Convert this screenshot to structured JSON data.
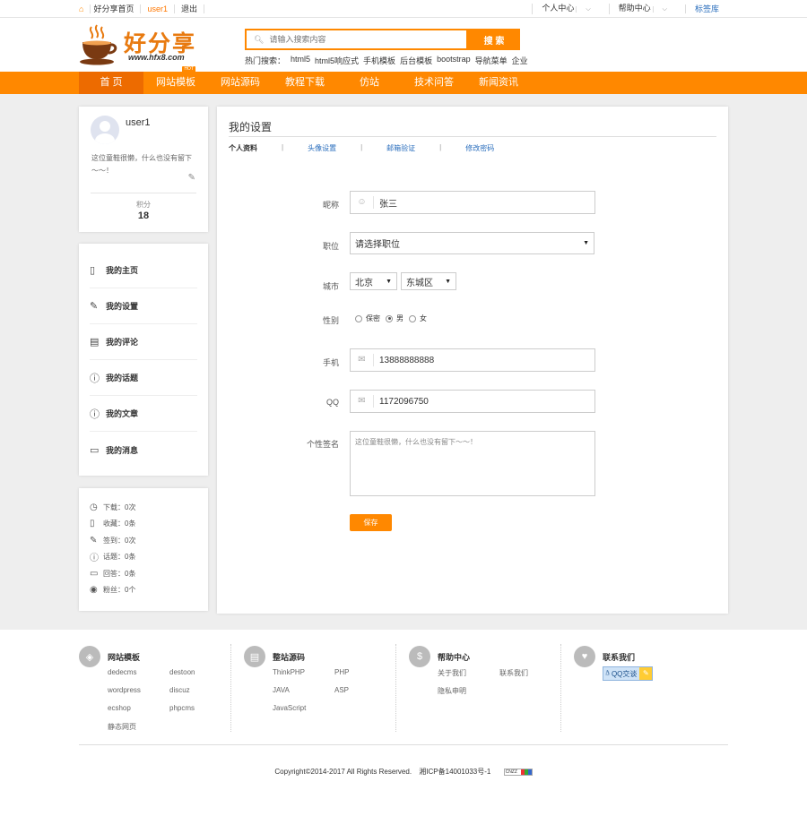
{
  "topbar": {
    "home": "好分享首页",
    "user": "user1",
    "logout": "退出",
    "right": [
      "个人中心",
      "帮助中心",
      "标签库"
    ]
  },
  "logo": {
    "title": "好分享",
    "url": "www.hfx8.com"
  },
  "search": {
    "placeholder": "请输入搜索内容",
    "button": "搜 索"
  },
  "hot_search": {
    "label": "热门搜索：",
    "items": [
      "html5",
      "html5响应式",
      "手机模板",
      "后台模板",
      "bootstrap",
      "导航菜单",
      "企业"
    ]
  },
  "nav": {
    "items": [
      "首 页",
      "网站模板",
      "网站源码",
      "教程下载",
      "仿站",
      "技术问答",
      "新闻资讯"
    ],
    "hot_badge": "HOT",
    "active_index": 0
  },
  "profile": {
    "username": "user1",
    "signature": "这位童鞋很懒，什么也没有留下～～！",
    "points_label": "积分",
    "points_value": "18"
  },
  "menu": {
    "items": [
      {
        "label": "我的主页",
        "icon": "home-doc-icon"
      },
      {
        "label": "我的设置",
        "icon": "pencil-icon"
      },
      {
        "label": "我的评论",
        "icon": "clipboard-icon"
      },
      {
        "label": "我的话题",
        "icon": "question-icon"
      },
      {
        "label": "我的文章",
        "icon": "question-icon"
      },
      {
        "label": "我的消息",
        "icon": "message-icon"
      }
    ]
  },
  "stats": {
    "items": [
      {
        "label": "下载：",
        "value": "0次"
      },
      {
        "label": "收藏：",
        "value": "0条"
      },
      {
        "label": "签到：",
        "value": "0次"
      },
      {
        "label": "话题：",
        "value": "0条"
      },
      {
        "label": "回答：",
        "value": "0条"
      },
      {
        "label": "粉丝：",
        "value": "0个"
      }
    ]
  },
  "settings": {
    "title": "我的设置",
    "tabs": [
      "个人资料",
      "头像设置",
      "邮箱验证",
      "修改密码"
    ],
    "active_tab": 0,
    "nickname_label": "昵称",
    "nickname_value": "张三",
    "position_label": "职位",
    "position_value": "请选择职位",
    "city_label": "城市",
    "city_value": "北京",
    "district_value": "东城区",
    "gender_label": "性别",
    "gender_options": [
      "保密",
      "男",
      "女"
    ],
    "gender_selected": 1,
    "phone_label": "手机",
    "phone_value": "13888888888",
    "qq_label": "QQ",
    "qq_value": "1172096750",
    "signature_label": "个性签名",
    "signature_value": "这位童鞋很懒，什么也没有留下～～！",
    "save_button": "保存"
  },
  "footer": {
    "columns": [
      {
        "title": "网站模板",
        "links": [
          "dedecms",
          "destoon",
          "wordpress",
          "discuz",
          "ecshop",
          "phpcms",
          "静态网页"
        ]
      },
      {
        "title": "整站源码",
        "links": [
          "ThinkPHP",
          "PHP",
          "JAVA",
          "ASP",
          "JavaScript"
        ]
      },
      {
        "title": "帮助中心",
        "links": [
          "关于我们",
          "联系我们",
          "隐私申明"
        ]
      },
      {
        "title": "联系我们",
        "qq_button": "QQ交谈"
      }
    ],
    "copyright": "Copyright©2014-2017 All Rights Reserved.",
    "icp": "湘ICP备14001033号-1",
    "cnzz": "CNZZ"
  },
  "colors": {
    "accent": "#ff8800",
    "nav_active": "#ed6b00",
    "link": "#2a6ebd",
    "page_bg": "#eeeeee"
  }
}
